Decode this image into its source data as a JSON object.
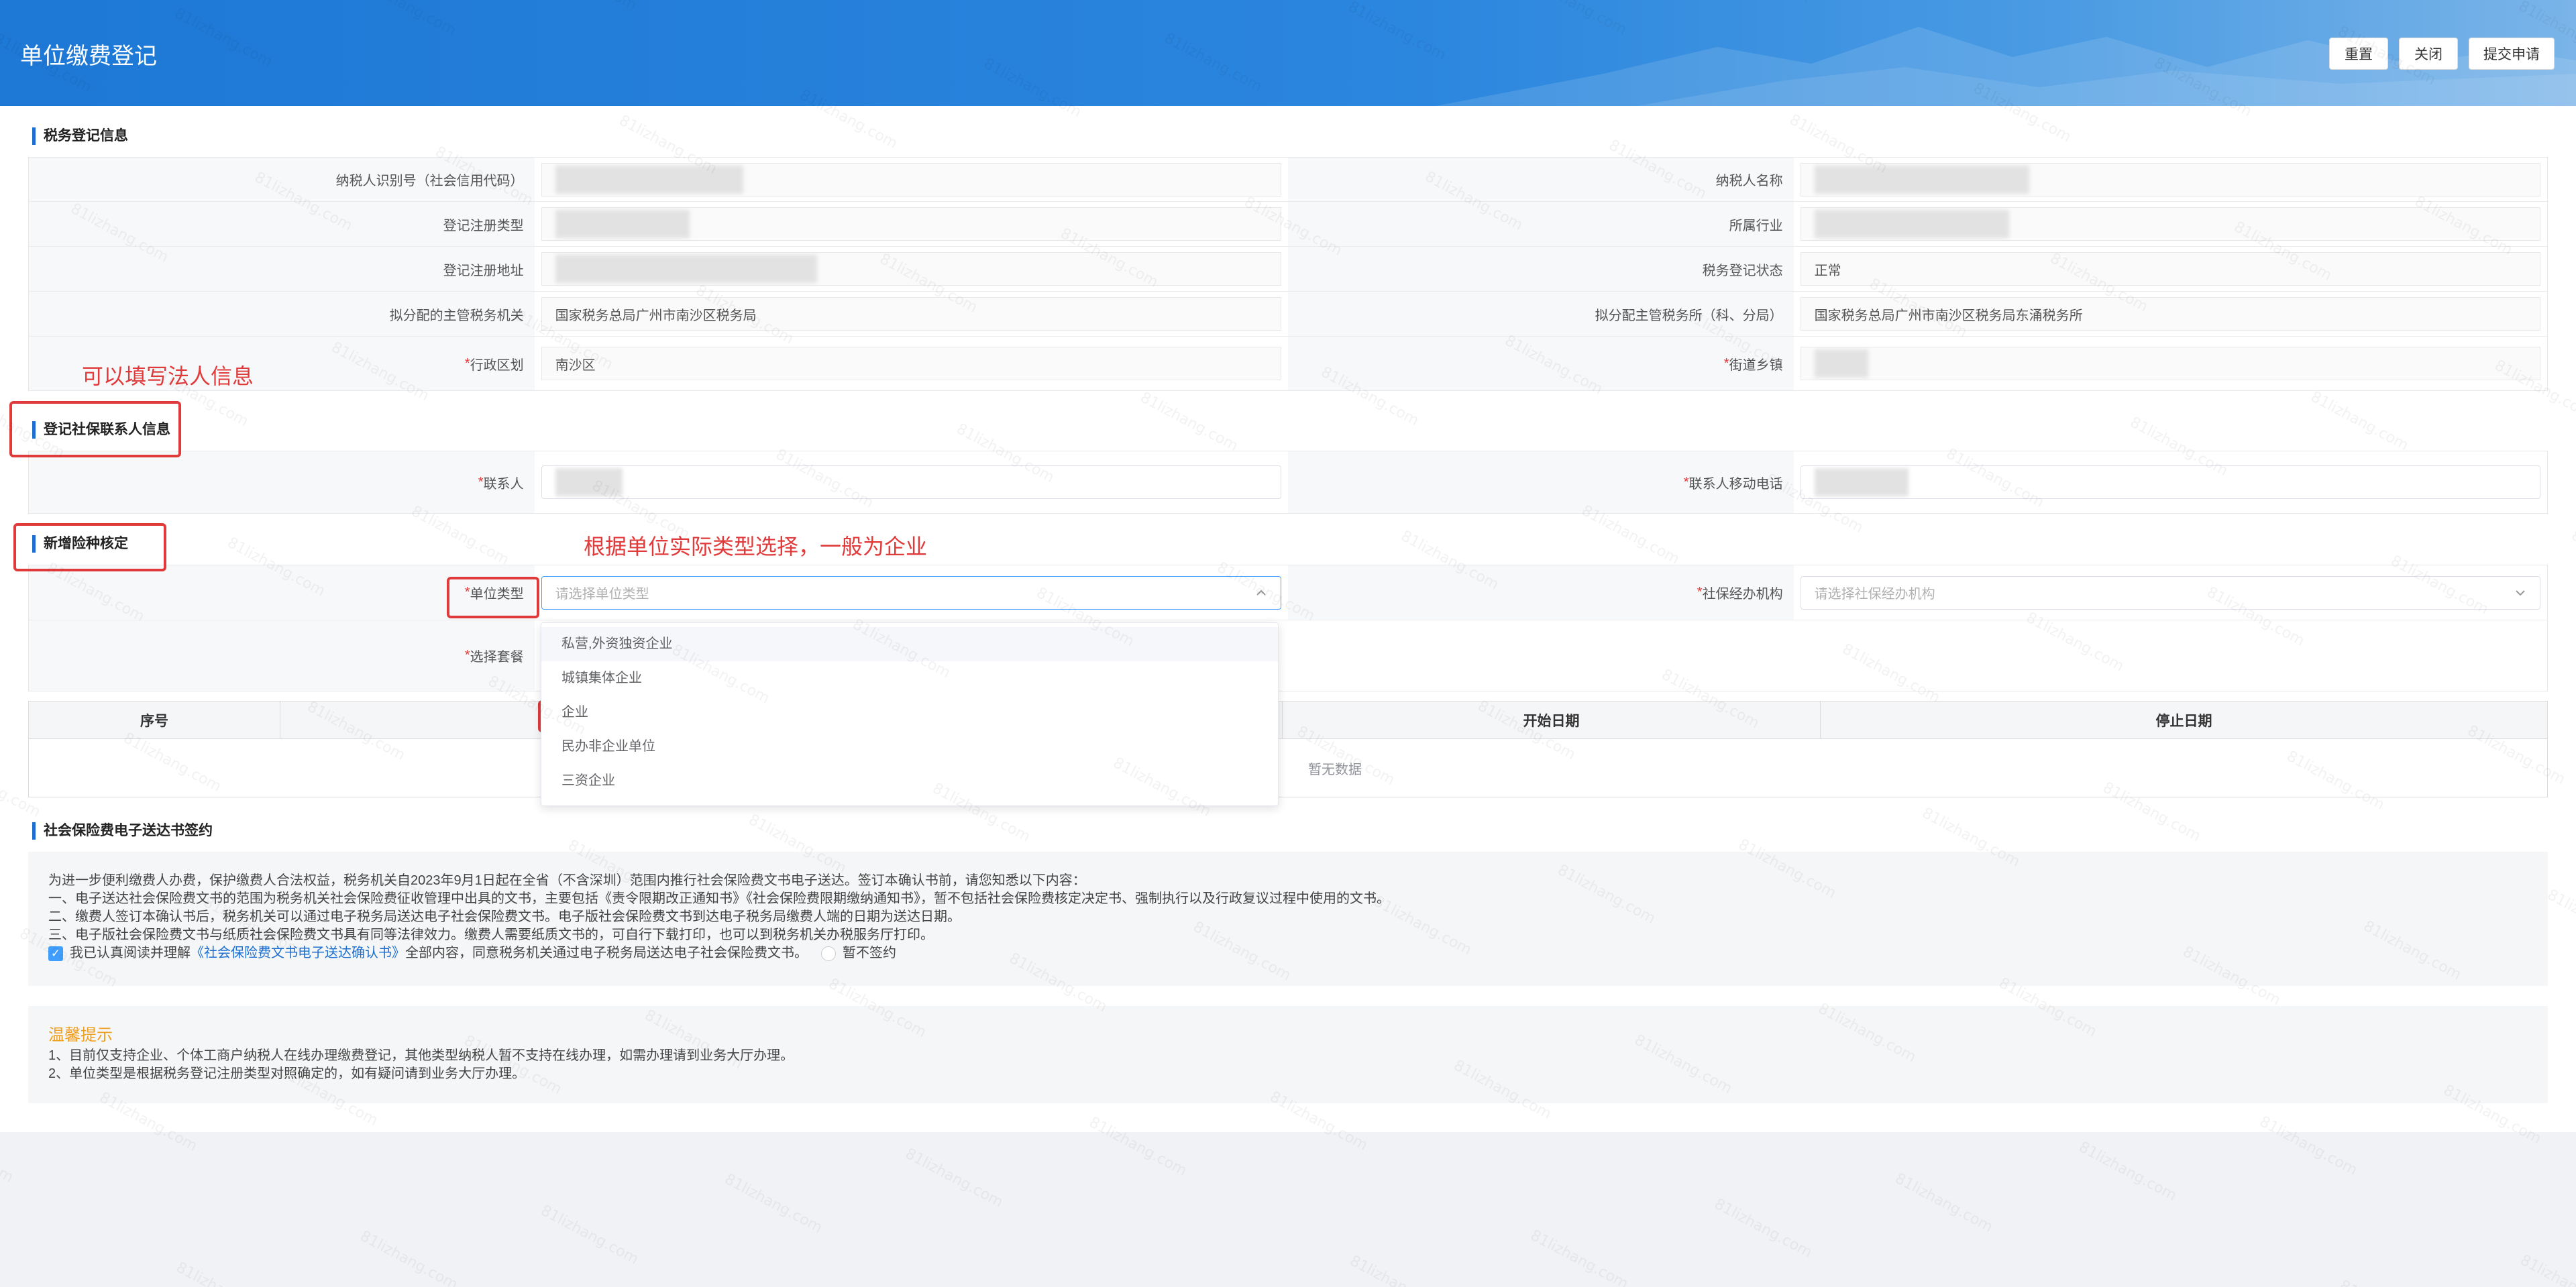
{
  "header": {
    "title": "单位缴费登记",
    "buttons": {
      "reset": "重置",
      "close": "关闭",
      "submit": "提交申请"
    }
  },
  "tax_section": {
    "title": "税务登记信息",
    "labels": {
      "taxpayer_id": "纳税人识别号（社会信用代码）",
      "taxpayer_name": "纳税人名称",
      "reg_type": "登记注册类型",
      "industry": "所属行业",
      "reg_address": "登记注册地址",
      "reg_status": "税务登记状态",
      "tax_authority": "拟分配的主管税务机关",
      "tax_office": "拟分配主管税务所（科、分局）",
      "district": "行政区划",
      "street": "街道乡镇"
    },
    "values": {
      "reg_status": "正常",
      "tax_authority": "国家税务总局广州市南沙区税务局",
      "tax_office": "国家税务总局广州市南沙区税务局东涌税务所",
      "district": "南沙区"
    },
    "required_mark": "*"
  },
  "contact_section": {
    "title": "登记社保联系人信息",
    "labels": {
      "contact": "联系人",
      "phone": "联系人移动电话"
    }
  },
  "insurance_section": {
    "title": "新增险种核定",
    "labels": {
      "unit_type": "单位类型",
      "agency": "社保经办机构",
      "package": "选择套餐"
    },
    "placeholders": {
      "unit_type": "请选择单位类型",
      "agency": "请选择社保经办机构"
    },
    "dropdown_options": [
      "私营,外资独资企业",
      "城镇集体企业",
      "企业",
      "民办非企业单位",
      "三资企业"
    ]
  },
  "table": {
    "columns": [
      "序号",
      "",
      "开始日期",
      "停止日期"
    ],
    "empty_text": "暂无数据"
  },
  "edelivery_section": {
    "title": "社会保险费电子送达书签约",
    "lines": [
      "为进一步便利缴费人办费，保护缴费人合法权益，税务机关自2023年9月1日起在全省（不含深圳）范围内推行社会保险费文书电子送达。签订本确认书前，请您知悉以下内容：",
      "一、电子送达社会保险费文书的范围为税务机关社会保险费征收管理中出具的文书，主要包括《责令限期改正通知书》《社会保险费限期缴纳通知书》，暂不包括社会保险费核定决定书、强制执行以及行政复议过程中使用的文书。",
      "二、缴费人签订本确认书后，税务机关可以通过电子税务局送达电子社会保险费文书。电子版社会保险费文书到达电子税务局缴费人端的日期为送达日期。",
      "三、电子版社会保险费文书与纸质社会保险费文书具有同等法律效力。缴费人需要纸质文书的，可自行下载打印，也可以到税务机关办税服务厅打印。"
    ],
    "agree_prefix": "我已认真阅读并理解",
    "agree_link": "《社会保险费文书电子送达确认书》",
    "agree_suffix": "全部内容，同意税务机关通过电子税务局送达电子社会保险费文书。",
    "decline": "暂不签约"
  },
  "tips": {
    "title": "温馨提示",
    "lines": [
      "1、目前仅支持企业、个体工商户纳税人在线办理缴费登记，其他类型纳税人暂不支持在线办理，如需办理请到业务大厅办理。",
      "2、单位类型是根据税务登记注册类型对照确定的，如有疑问请到业务大厅办理。"
    ]
  },
  "annotations": {
    "legal_person": "可以填写法人信息",
    "unit_type_hint": "根据单位实际类型选择，一般为企业"
  },
  "colors": {
    "header_blue": "#1d78d6",
    "accent": "#409eff",
    "annotation_red": "#e03a3a",
    "tips_orange": "#f0a020"
  }
}
